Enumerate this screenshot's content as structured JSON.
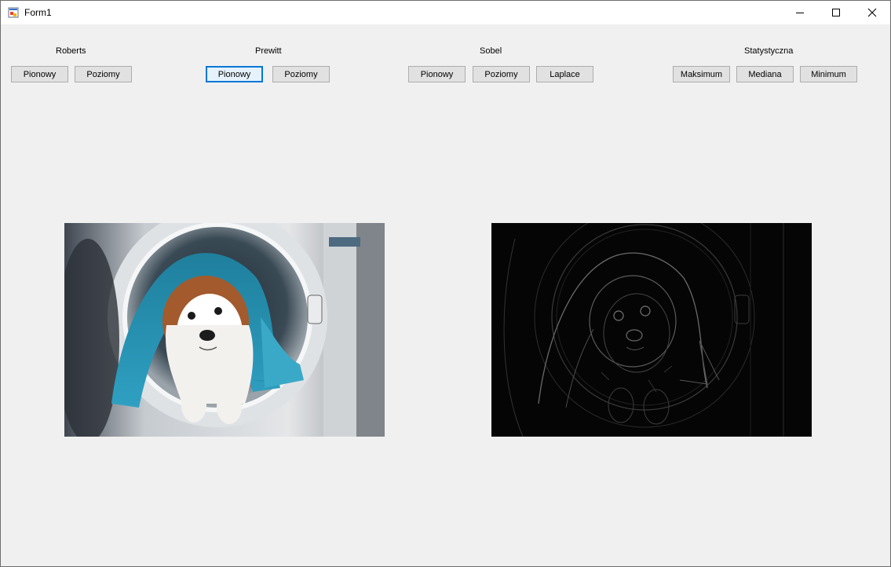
{
  "window": {
    "title": "Form1"
  },
  "groups": {
    "roberts": {
      "label": "Roberts",
      "buttons": [
        "Pionowy",
        "Poziomy"
      ]
    },
    "prewitt": {
      "label": "Prewitt",
      "buttons": [
        "Pionowy",
        "Poziomy"
      ]
    },
    "sobel": {
      "label": "Sobel",
      "buttons": [
        "Pionowy",
        "Poziomy",
        "Laplace"
      ]
    },
    "statystyczna": {
      "label": "Statystyczna",
      "buttons": [
        "Maksimum",
        "Mediana",
        "Minimum"
      ]
    }
  },
  "focused_button": "prewitt.Pionowy",
  "images": {
    "original": "original-photo-dog-in-washing-machine",
    "processed": "edge-detected-photo"
  },
  "colors": {
    "focus_border": "#0078d7",
    "towel_teal": "#2a8fae",
    "processed_background": "#050505"
  }
}
